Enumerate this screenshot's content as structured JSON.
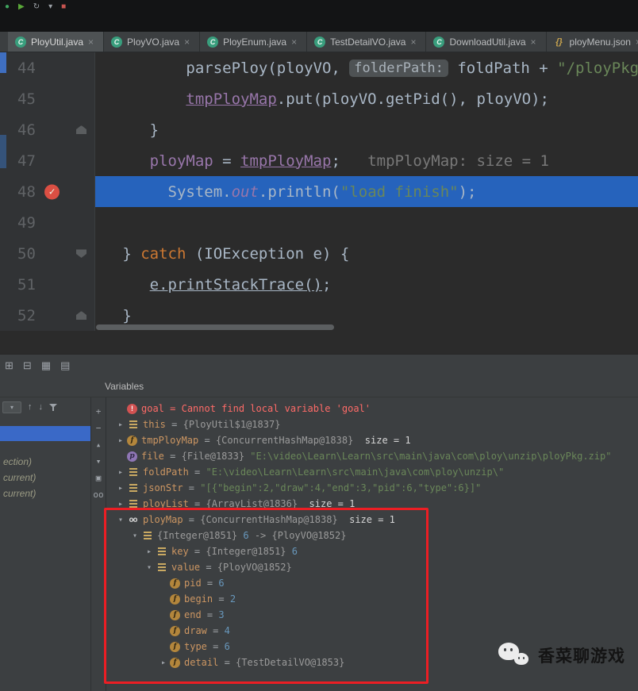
{
  "topbar": {
    "icons": [
      {
        "name": "app-icon",
        "glyph": "●",
        "cls": "ic-teal"
      },
      {
        "name": "run-icon",
        "glyph": "▶",
        "cls": "ic-green"
      },
      {
        "name": "sync-icon",
        "glyph": "↻",
        "cls": "ic-gray"
      },
      {
        "name": "dropdown-arrow-icon",
        "glyph": "▾",
        "cls": "ic-gray"
      },
      {
        "name": "stop-icon",
        "glyph": "■",
        "cls": "ic-red"
      }
    ]
  },
  "tabs": {
    "items": [
      {
        "label": "PloyUtil.java",
        "cls": "selected",
        "iconcls": "ic-class",
        "icon_name": "java-class-icon",
        "icon_glyph": "C"
      },
      {
        "label": "PloyVO.java",
        "cls": "",
        "iconcls": "ic-class",
        "icon_name": "java-class-icon",
        "icon_glyph": "C"
      },
      {
        "label": "PloyEnum.java",
        "cls": "",
        "iconcls": "ic-class",
        "icon_name": "java-class-icon",
        "icon_glyph": "C"
      },
      {
        "label": "TestDetailVO.java",
        "cls": "",
        "iconcls": "ic-class",
        "icon_name": "java-class-icon",
        "icon_glyph": "C"
      },
      {
        "label": "DownloadUtil.java",
        "cls": "",
        "iconcls": "ic-class",
        "icon_name": "java-class-icon",
        "icon_glyph": "C"
      },
      {
        "label": "ployMenu.json",
        "cls": "",
        "iconcls": "ic-json",
        "icon_name": "json-file-icon",
        "icon_glyph": "{}"
      }
    ]
  },
  "editor": {
    "lines": [
      {
        "num": "44",
        "marker": "m-none",
        "marker_name": "",
        "linecls": "",
        "segments": [
          {
            "t": "          parsePloy(ployVO, ",
            "c": "plain"
          },
          {
            "t": "folderPath:",
            "c": "hint"
          },
          {
            "t": " foldPath + ",
            "c": "plain"
          },
          {
            "t": "\"/ployPkg\"",
            "c": "str"
          },
          {
            "t": ");",
            "c": "plain"
          }
        ]
      },
      {
        "num": "45",
        "marker": "m-none",
        "marker_name": "",
        "linecls": "",
        "segments": [
          {
            "t": "          ",
            "c": "plain"
          },
          {
            "t": "tmpPloyMap",
            "c": "field-u"
          },
          {
            "t": ".put(ployVO.getPid(), ployVO);",
            "c": "plain"
          }
        ]
      },
      {
        "num": "46",
        "marker": "m-fold-up",
        "marker_name": "fold-end-icon",
        "linecls": "",
        "segments": [
          {
            "t": "      }",
            "c": "plain"
          }
        ]
      },
      {
        "num": "47",
        "marker": "m-none",
        "marker_name": "",
        "linecls": "",
        "segments": [
          {
            "t": "      ",
            "c": "plain"
          },
          {
            "t": "ployMap",
            "c": "field"
          },
          {
            "t": " = ",
            "c": "plain"
          },
          {
            "t": "tmpPloyMap",
            "c": "field-u"
          },
          {
            "t": ";",
            "c": "plain"
          },
          {
            "t": "   ",
            "c": "plain"
          },
          {
            "t": "tmpPloyMap: size = 1",
            "c": "dbg-hint"
          }
        ]
      },
      {
        "num": "48",
        "marker": "m-bp",
        "marker_name": "breakpoint-icon",
        "linecls": "current",
        "segments": [
          {
            "t": "        System.",
            "c": "plain"
          },
          {
            "t": "out",
            "c": "static"
          },
          {
            "t": ".println(",
            "c": "plain"
          },
          {
            "t": "\"load finish\"",
            "c": "str"
          },
          {
            "t": ");",
            "c": "plain"
          }
        ]
      },
      {
        "num": "49",
        "marker": "m-none",
        "marker_name": "",
        "linecls": "",
        "segments": []
      },
      {
        "num": "50",
        "marker": "m-fold-down",
        "marker_name": "fold-start-icon",
        "linecls": "",
        "segments": [
          {
            "t": "   } ",
            "c": "plain"
          },
          {
            "t": "catch",
            "c": "kw"
          },
          {
            "t": " (IOException e) {",
            "c": "plain"
          }
        ]
      },
      {
        "num": "51",
        "marker": "m-none",
        "marker_name": "",
        "linecls": "",
        "segments": [
          {
            "t": "      ",
            "c": "plain"
          },
          {
            "t": "e.printStackTrace()",
            "c": "u"
          },
          {
            "t": ";",
            "c": "plain"
          }
        ]
      },
      {
        "num": "52",
        "marker": "m-fold-up",
        "marker_name": "fold-end-icon",
        "linecls": "",
        "segments": [
          {
            "t": "   }",
            "c": "plain"
          }
        ]
      }
    ]
  },
  "debugger_panel": {
    "variables_title": "Variables",
    "toolbar_icons": [
      {
        "name": "restore-layout-icon",
        "glyph": "⊞"
      },
      {
        "name": "evaluate-expression-icon",
        "glyph": "⊟"
      },
      {
        "name": "grid-view-icon",
        "glyph": "▦"
      },
      {
        "name": "list-view-icon",
        "glyph": "▤"
      }
    ],
    "frames_toolbar": {
      "combo_arrow": "▾",
      "up": "↑",
      "down": "↓"
    },
    "frames": [
      "ection)",
      "current)",
      "current)"
    ],
    "watch_toolbar": [
      {
        "name": "add-watch-icon",
        "glyph": "+"
      },
      {
        "name": "remove-watch-icon",
        "glyph": "−"
      },
      {
        "name": "move-watch-up-icon",
        "glyph": "▴"
      },
      {
        "name": "move-watch-down-icon",
        "glyph": "▾"
      },
      {
        "name": "duplicate-watch-icon",
        "glyph": "▣"
      },
      {
        "name": "show-watches-icon",
        "glyph": "oo"
      }
    ],
    "variables": [
      {
        "depth": "d0",
        "chev": "none",
        "icon": "vi-error",
        "icon_name": "error-icon",
        "segments": [
          {
            "t": "goal",
            "c": "verr"
          },
          {
            "t": " = ",
            "c": "verr"
          },
          {
            "t": "Cannot find local variable 'goal'",
            "c": "verr"
          }
        ]
      },
      {
        "depth": "d0",
        "chev": "right",
        "icon": "vi-bars",
        "icon_name": "variable-icon",
        "segments": [
          {
            "t": "this",
            "c": "vn"
          },
          {
            "t": " = ",
            "c": "veq"
          },
          {
            "t": "{PloyUtil$1@1837}",
            "c": "vref"
          }
        ]
      },
      {
        "depth": "d0",
        "chev": "right",
        "icon": "vi-field",
        "icon_name": "field-icon",
        "segments": [
          {
            "t": "tmpPloyMap",
            "c": "vn"
          },
          {
            "t": " = ",
            "c": "veq"
          },
          {
            "t": "{ConcurrentHashMap@1838}",
            "c": "vref"
          },
          {
            "t": "  size = 1",
            "c": "vsize"
          }
        ]
      },
      {
        "depth": "d0",
        "chev": "none",
        "icon": "vi-param",
        "icon_name": "parameter-icon",
        "segments": [
          {
            "t": "file",
            "c": "vn"
          },
          {
            "t": " = ",
            "c": "veq"
          },
          {
            "t": "{File@1833} ",
            "c": "vref"
          },
          {
            "t": "\"E:\\video\\Learn\\Learn\\src\\main\\java\\com\\ploy\\unzip\\ployPkg.zip\"",
            "c": "vstr"
          }
        ]
      },
      {
        "depth": "d0",
        "chev": "right",
        "icon": "vi-bars",
        "icon_name": "variable-icon",
        "segments": [
          {
            "t": "foldPath",
            "c": "vn"
          },
          {
            "t": " = ",
            "c": "veq"
          },
          {
            "t": "\"E:\\video\\Learn\\Learn\\src\\main\\java\\com\\ploy\\unzip\\\"",
            "c": "vstr"
          }
        ]
      },
      {
        "depth": "d0",
        "chev": "right",
        "icon": "vi-bars",
        "icon_name": "variable-icon",
        "segments": [
          {
            "t": "jsonStr",
            "c": "vn"
          },
          {
            "t": " = ",
            "c": "veq"
          },
          {
            "t": "\"[{\"begin\":2,\"draw\":4,\"end\":3,\"pid\":6,\"type\":6}]\"",
            "c": "vstr"
          }
        ]
      },
      {
        "depth": "d0",
        "chev": "right",
        "icon": "vi-bars",
        "icon_name": "variable-icon",
        "segments": [
          {
            "t": "ployList",
            "c": "vn"
          },
          {
            "t": " = ",
            "c": "veq"
          },
          {
            "t": "{ArrayList@1836}",
            "c": "vref"
          },
          {
            "t": "  size = 1",
            "c": "vsize"
          }
        ]
      },
      {
        "depth": "d0",
        "chev": "down",
        "icon": "vi-glasses",
        "icon_name": "watch-glasses-icon",
        "segments": [
          {
            "t": "ployMap",
            "c": "vn"
          },
          {
            "t": " = ",
            "c": "veq"
          },
          {
            "t": "{ConcurrentHashMap@1838}",
            "c": "vref"
          },
          {
            "t": "  size = 1",
            "c": "vsize"
          }
        ]
      },
      {
        "depth": "d1",
        "chev": "down",
        "icon": "vi-bars",
        "icon_name": "map-entry-icon",
        "segments": [
          {
            "t": "{Integer@1851} ",
            "c": "vref"
          },
          {
            "t": "6",
            "c": "vnum"
          },
          {
            "t": " -> ",
            "c": "vref"
          },
          {
            "t": "{PloyVO@1852}",
            "c": "vref"
          }
        ]
      },
      {
        "depth": "d2",
        "chev": "right",
        "icon": "vi-bars",
        "icon_name": "variable-icon",
        "segments": [
          {
            "t": "key",
            "c": "vn"
          },
          {
            "t": " = ",
            "c": "veq"
          },
          {
            "t": "{Integer@1851} ",
            "c": "vref"
          },
          {
            "t": "6",
            "c": "vnum"
          }
        ]
      },
      {
        "depth": "d2",
        "chev": "down",
        "icon": "vi-bars",
        "icon_name": "variable-icon",
        "segments": [
          {
            "t": "value",
            "c": "vn"
          },
          {
            "t": " = ",
            "c": "veq"
          },
          {
            "t": "{PloyVO@1852}",
            "c": "vref"
          }
        ]
      },
      {
        "depth": "d3",
        "chev": "none",
        "icon": "vi-field",
        "icon_name": "field-icon",
        "segments": [
          {
            "t": "pid",
            "c": "vn"
          },
          {
            "t": " = ",
            "c": "veq"
          },
          {
            "t": "6",
            "c": "vnum"
          }
        ]
      },
      {
        "depth": "d3",
        "chev": "none",
        "icon": "vi-field",
        "icon_name": "field-icon",
        "segments": [
          {
            "t": "begin",
            "c": "vn"
          },
          {
            "t": " = ",
            "c": "veq"
          },
          {
            "t": "2",
            "c": "vnum"
          }
        ]
      },
      {
        "depth": "d3",
        "chev": "none",
        "icon": "vi-field",
        "icon_name": "field-icon",
        "segments": [
          {
            "t": "end",
            "c": "vn"
          },
          {
            "t": " = ",
            "c": "veq"
          },
          {
            "t": "3",
            "c": "vnum"
          }
        ]
      },
      {
        "depth": "d3",
        "chev": "none",
        "icon": "vi-field",
        "icon_name": "field-icon",
        "segments": [
          {
            "t": "draw",
            "c": "vn"
          },
          {
            "t": " = ",
            "c": "veq"
          },
          {
            "t": "4",
            "c": "vnum"
          }
        ]
      },
      {
        "depth": "d3",
        "chev": "none",
        "icon": "vi-field",
        "icon_name": "field-icon",
        "segments": [
          {
            "t": "type",
            "c": "vn"
          },
          {
            "t": " = ",
            "c": "veq"
          },
          {
            "t": "6",
            "c": "vnum"
          }
        ]
      },
      {
        "depth": "d3",
        "chev": "right",
        "icon": "vi-field",
        "icon_name": "field-icon",
        "segments": [
          {
            "t": "detail",
            "c": "vn"
          },
          {
            "t": " = ",
            "c": "veq"
          },
          {
            "t": "{TestDetailVO@1853}",
            "c": "vref"
          }
        ]
      }
    ]
  },
  "watermark": {
    "text": "香菜聊游戏"
  },
  "colors": {
    "execution_line": "#2663bc",
    "annotation_red": "#ec1e24",
    "editor_bg": "#2b2b2b",
    "panel_bg": "#3c3f41",
    "string_green": "#6a8759",
    "keyword_orange": "#cc7832",
    "field_purple": "#9876aa",
    "error_red": "#ff6b68",
    "number_blue": "#6897bb"
  }
}
